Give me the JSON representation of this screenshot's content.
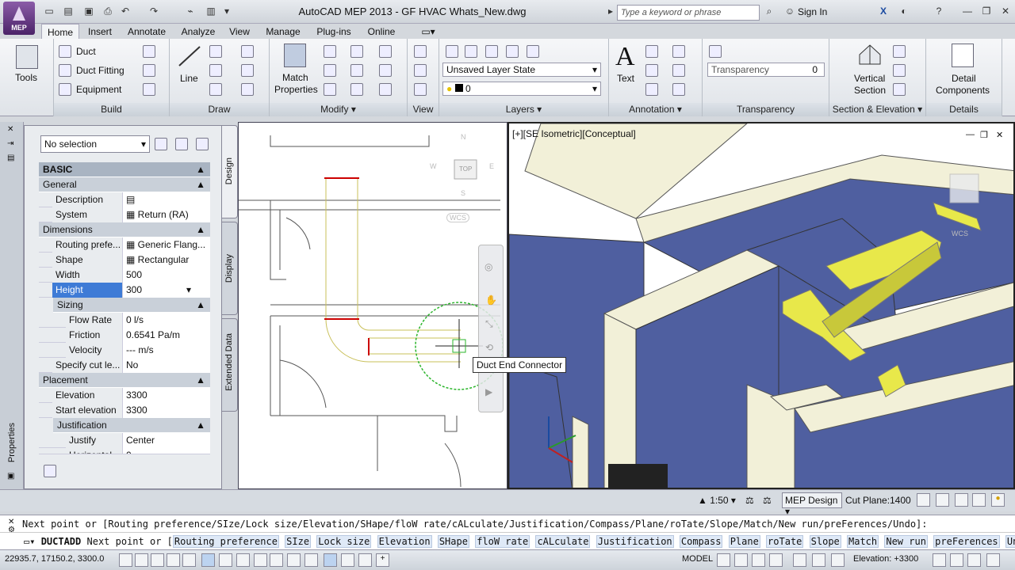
{
  "app": {
    "logo_text": "MEP",
    "title": "AutoCAD MEP 2013 - GF HVAC Whats_New.dwg",
    "search_placeholder": "Type a keyword or phrase",
    "signin": "Sign In"
  },
  "tabs": [
    "Home",
    "Insert",
    "Annotate",
    "Analyze",
    "View",
    "Manage",
    "Plug-ins",
    "Online"
  ],
  "ribbon": {
    "build": {
      "label": "Build",
      "tools": "Tools",
      "duct": "Duct",
      "duct_fitting": "Duct Fitting",
      "equipment": "Equipment"
    },
    "draw": {
      "label": "Draw",
      "line": "Line"
    },
    "modify": {
      "label": "Modify",
      "match": "Match",
      "properties": "Properties"
    },
    "view": {
      "label": "View"
    },
    "layers": {
      "label": "Layers",
      "layer_state": "Unsaved Layer State",
      "layer": "0"
    },
    "annotation": {
      "label": "Annotation",
      "text": "Text"
    },
    "transparency": {
      "label": "Transparency",
      "field": "Transparency",
      "value": "0"
    },
    "section": {
      "label": "Section & Elevation",
      "vertical": "Vertical",
      "section": "Section"
    },
    "details": {
      "label": "Details",
      "detail": "Detail",
      "components": "Components"
    }
  },
  "properties": {
    "selection": "No selection",
    "title": "Properties",
    "tabs": [
      "Design",
      "Display",
      "Extended Data"
    ],
    "basic": "BASIC",
    "general": "General",
    "rows_general": [
      {
        "k": "Description",
        "v": ""
      },
      {
        "k": "System",
        "v": "Return (RA)"
      }
    ],
    "dimensions": "Dimensions",
    "rows_dim": [
      {
        "k": "Routing prefe...",
        "v": "Generic Flang..."
      },
      {
        "k": "Shape",
        "v": "Rectangular"
      },
      {
        "k": "Width",
        "v": "500"
      },
      {
        "k": "Height",
        "v": "300"
      }
    ],
    "sizing": "Sizing",
    "rows_sizing": [
      {
        "k": "Flow Rate",
        "v": "0 l/s"
      },
      {
        "k": "Friction",
        "v": "0.6541 Pa/m"
      },
      {
        "k": "Velocity",
        "v": "--- m/s"
      }
    ],
    "specify": {
      "k": "Specify cut le...",
      "v": "No"
    },
    "placement": "Placement",
    "rows_place": [
      {
        "k": "Elevation",
        "v": "3300"
      },
      {
        "k": "Start elevation",
        "v": "3300"
      }
    ],
    "justification": "Justification",
    "rows_just": [
      {
        "k": "Justify",
        "v": "Center"
      },
      {
        "k": "Horizontal ...",
        "v": "0"
      }
    ]
  },
  "viewport1": {
    "viewcube": {
      "top": "TOP",
      "n": "N",
      "s": "S",
      "w": "W",
      "e": "E",
      "wcs": "WCS"
    }
  },
  "viewport2": {
    "label": "[+][SE Isometric][Conceptual]",
    "wcs": "WCS"
  },
  "tooltip": "Duct End Connector",
  "status_row": {
    "scale": "1:50",
    "workspace": "MEP Design",
    "cut_plane_label": "Cut Plane:",
    "cut_plane": "1400"
  },
  "command": {
    "history": "Next point or [Routing preference/SIze/Lock size/Elevation/SHape/floW rate/cALculate/Justification/Compass/Plane/roTate/Slope/Match/New run/preFerences/Undo]:",
    "name": "DUCTADD",
    "prompt": "Next point or [",
    "end": "]:",
    "options": [
      "Routing preference",
      "SIze",
      "Lock size",
      "Elevation",
      "SHape",
      "floW rate",
      "cALculate",
      "Justification",
      "Compass",
      "Plane",
      "roTate",
      "Slope",
      "Match",
      "New run",
      "preFerences",
      "Undo"
    ]
  },
  "statusbar": {
    "coords": "22935.7, 17150.2, 3300.0",
    "model": "MODEL",
    "elevation": "Elevation: +3300"
  },
  "colors": {
    "duct": "#e8e84a",
    "walls": "#4f5fa0",
    "wall_top": "#f2f0d8",
    "selection": "#3e7bd6"
  }
}
